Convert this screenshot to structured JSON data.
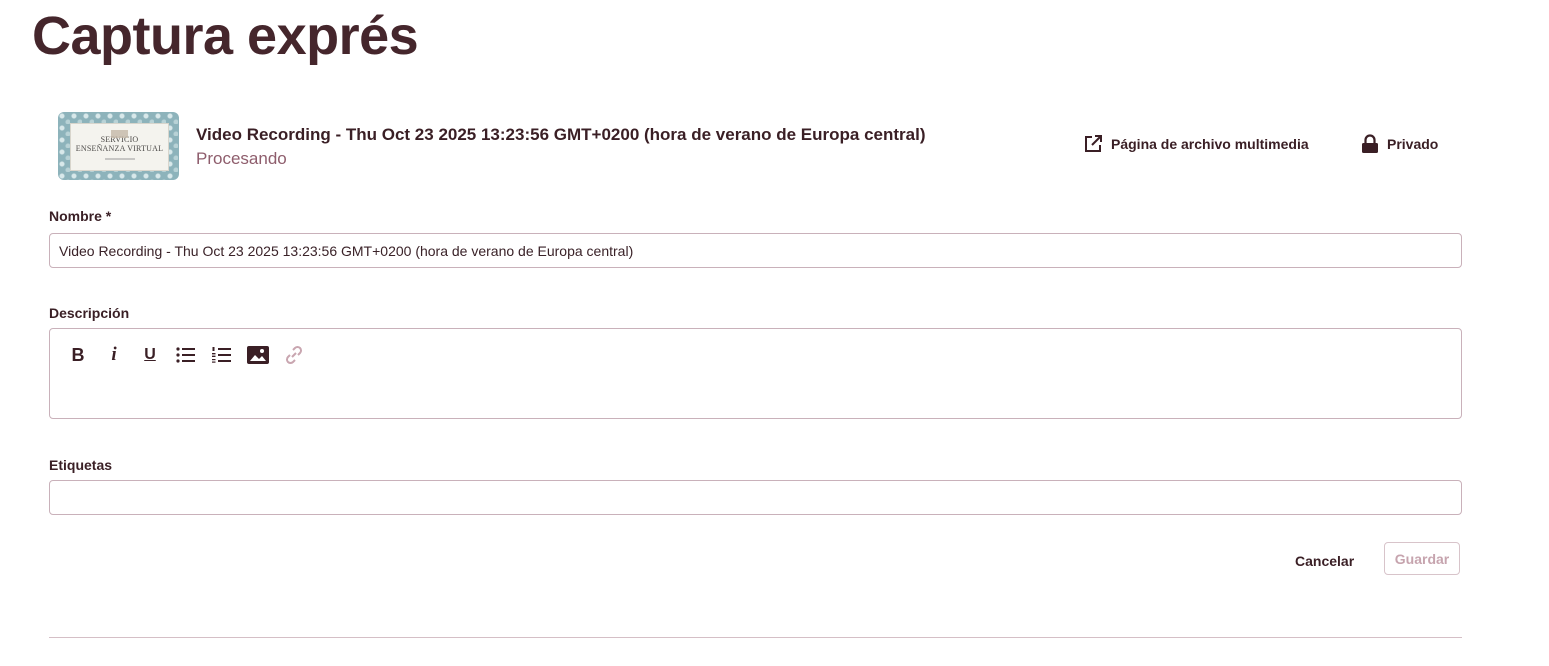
{
  "page": {
    "title": "Captura exprés"
  },
  "media": {
    "thumbnail_text_line1": "SERVICIO",
    "thumbnail_text_line2": "ENSEÑANZA VIRTUAL",
    "title": "Video Recording - Thu Oct 23 2025 13:23:56 GMT+0200 (hora de verano de Europa central)",
    "status": "Procesando",
    "media_page_link_label": "Página de archivo multimedia",
    "media_page_link_icon": "external-link-icon",
    "privacy_label": "Privado",
    "privacy_icon": "lock-icon"
  },
  "form": {
    "name": {
      "label": "Nombre *",
      "value": "Video Recording - Thu Oct 23 2025 13:23:56 GMT+0200 (hora de verano de Europa central)"
    },
    "description": {
      "label": "Descripción",
      "value": "",
      "toolbar": {
        "bold_glyph": "B",
        "italic_glyph": "i",
        "underline_glyph": "U",
        "icons": [
          "bold-icon",
          "italic-icon",
          "underline-icon",
          "bulleted-list-icon",
          "numbered-list-icon",
          "image-icon",
          "link-icon"
        ]
      }
    },
    "tags": {
      "label": "Etiquetas",
      "value": ""
    },
    "cancel_label": "Cancelar",
    "save_label": "Guardar"
  },
  "colors": {
    "text_primary": "#3a1f25",
    "status": "#8e5d6c",
    "border": "#c9b1ba",
    "disabled": "#c6a4ae"
  }
}
